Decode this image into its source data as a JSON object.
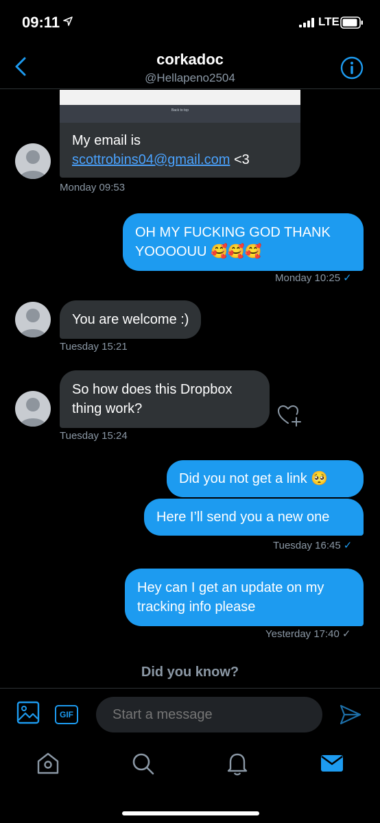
{
  "status_bar": {
    "time": "09:11",
    "network": "LTE"
  },
  "header": {
    "name": "corkadoc",
    "handle": "@Hellapeno2504"
  },
  "messages": [
    {
      "direction": "in",
      "attachment_caption": "Back to top",
      "text_prefix": "My email is",
      "link": "scottrobins04@gmail.com",
      "text_suffix": " <3",
      "timestamp": "Monday 09:53"
    },
    {
      "direction": "out",
      "lines": [
        "OH MY FUCKING GOD THANK",
        "YOOOOUU 🥰🥰🥰"
      ],
      "timestamp": "Monday 10:25"
    },
    {
      "direction": "in",
      "lines": [
        "You are welcome :)"
      ],
      "timestamp": "Tuesday 15:21"
    },
    {
      "direction": "in",
      "lines": [
        "So how does this Dropbox",
        "thing work?"
      ],
      "timestamp": "Tuesday 15:24"
    },
    {
      "direction": "out",
      "lines": [
        "Did you not get a link 🥺"
      ]
    },
    {
      "direction": "out",
      "lines": [
        "Here I’ll send you a new one"
      ],
      "timestamp": "Tuesday 16:45"
    },
    {
      "direction": "out",
      "lines": [
        "Hey can I get an update on my",
        "tracking info please"
      ],
      "timestamp": "Yesterday 17:40"
    }
  ],
  "read_tick": "✓",
  "did_you_know": "Did you know?",
  "composer": {
    "placeholder": "Start a message",
    "gif_label": "GIF"
  },
  "colors": {
    "accent": "#1d9bf0",
    "incoming_bubble": "#2f3336",
    "muted": "#8b98a5",
    "background": "#000000"
  },
  "icons": [
    "back-chevron-icon",
    "info-icon",
    "image-icon",
    "gif-icon",
    "send-icon",
    "home-icon",
    "search-icon",
    "bell-icon",
    "mail-icon",
    "heart-add-icon"
  ]
}
